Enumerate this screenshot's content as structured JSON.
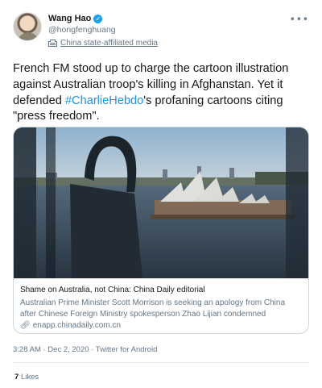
{
  "tweet": {
    "author": {
      "name": "Wang Hao",
      "handle": "@hongfenghuang",
      "affiliation": "China state-affiliated media"
    },
    "text_before": "French FM stood up to charge the cartoon illustration against Australian troop's killing in Afghanstan. Yet it defended ",
    "hashtag": "#CharlieHebdo",
    "text_after": "'s profaning cartoons citing \"press freedom\".",
    "card": {
      "title": "Shame on Australia, not China: China Daily editorial",
      "description": "Australian Prime Minister Scott Morrison is seeking an apology from China after Chinese Foreign Ministry spokesperson Zhao Lijian condemned Australian soldie...",
      "domain": "enapp.chinadaily.com.cn"
    },
    "timestamp": "3:28 AM · Dec 2, 2020 · Twitter for Android",
    "likes_count": "7",
    "likes_label": "Likes"
  },
  "icons": {
    "verified": "verified-badge-icon",
    "affiliation": "state-media-flag-icon",
    "more": "more-options-icon",
    "link": "link-icon"
  },
  "colors": {
    "accent": "#1da1f2",
    "hashtag": "#1b95e0",
    "secondary_text": "#657786",
    "border": "#ccd6dd"
  }
}
